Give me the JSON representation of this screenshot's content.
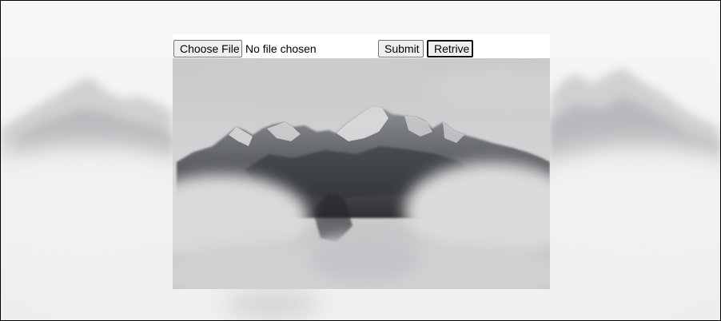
{
  "upload_form": {
    "choose_file_label": "Choose File",
    "file_status": "No file chosen",
    "submit_label": "Submit",
    "retrive_label": "Retrive"
  },
  "icons": {
    "background": "misty-mountain-background-image",
    "photo": "snowy-mountain-peak-in-clouds-image"
  },
  "colors": {
    "page_background": "#f2f2f2",
    "button_background": "#efefef",
    "button_border": "#767676",
    "photo_sky": "#c9cbcd",
    "mountain_dark": "#3a3c40"
  }
}
